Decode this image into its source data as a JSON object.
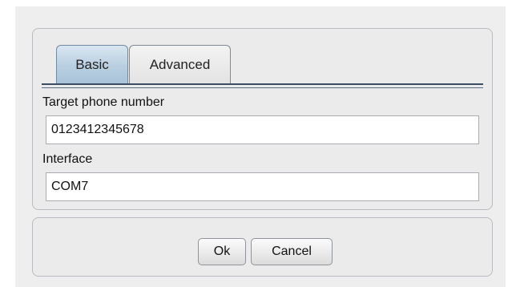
{
  "tabs": [
    {
      "label": "Basic",
      "active": true
    },
    {
      "label": "Advanced",
      "active": false
    }
  ],
  "form": {
    "target_label": "Target phone number",
    "target_value": "0123412345678",
    "interface_label": "Interface",
    "interface_value": "COM7"
  },
  "buttons": {
    "ok_label": "Ok",
    "cancel_label": "Cancel"
  },
  "colors": {
    "active_tab": "#b9cfe1",
    "background": "#eeeeee",
    "tab_line": "#3b4d63"
  }
}
